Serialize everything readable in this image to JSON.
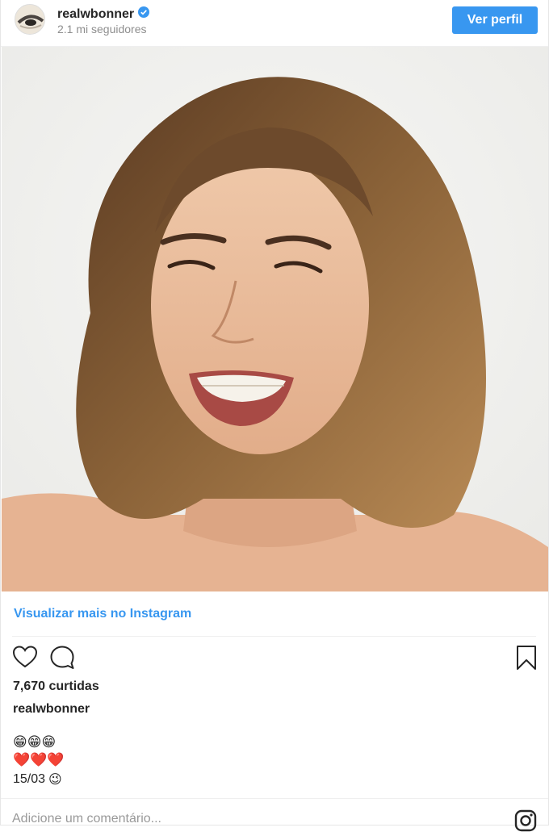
{
  "header": {
    "username": "realwbonner",
    "followers": "2.1 mi seguidores",
    "profile_button": "Ver perfil"
  },
  "post": {
    "view_more_link": "Visualizar mais no Instagram",
    "likes": "7,670 curtidas",
    "caption_user": "realwbonner",
    "caption_line1": "😁😁😁",
    "caption_line2": "❤️❤️❤️",
    "caption_date": "15/03",
    "caption_date_emoji": "😉"
  },
  "comment": {
    "placeholder": "Adicione um comentário..."
  },
  "colors": {
    "accent": "#3897f0",
    "verified": "#3897f0"
  },
  "icons": [
    "verified-badge-icon",
    "heart-icon",
    "comment-icon",
    "bookmark-icon",
    "instagram-icon"
  ]
}
